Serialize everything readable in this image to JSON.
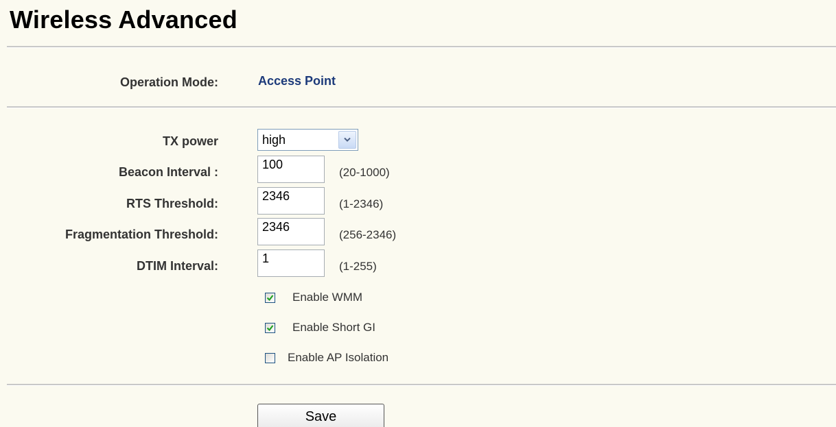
{
  "page": {
    "title": "Wireless Advanced"
  },
  "operation_mode": {
    "label": "Operation Mode:",
    "value": "Access Point"
  },
  "tx_power": {
    "label": "TX power",
    "selected": "high"
  },
  "beacon_interval": {
    "label": "Beacon Interval :",
    "value": "100",
    "range": "(20-1000)"
  },
  "rts_threshold": {
    "label": "RTS Threshold:",
    "value": "2346",
    "range": "(1-2346)"
  },
  "fragmentation_threshold": {
    "label": "Fragmentation Threshold:",
    "value": "2346",
    "range": "(256-2346)"
  },
  "dtim_interval": {
    "label": "DTIM Interval:",
    "value": "1",
    "range": "(1-255)"
  },
  "checkboxes": [
    {
      "label": "Enable WMM",
      "checked": true
    },
    {
      "label": "Enable Short GI",
      "checked": true
    },
    {
      "label": "Enable AP Isolation",
      "checked": false
    }
  ],
  "actions": {
    "save_label": "Save"
  },
  "colors": {
    "background": "#fbfaf0",
    "accent_value": "#1c3a7a",
    "check_mark": "#21a121"
  },
  "icons": {
    "dropdown": "chevron-down-icon",
    "check": "checkmark-icon"
  }
}
